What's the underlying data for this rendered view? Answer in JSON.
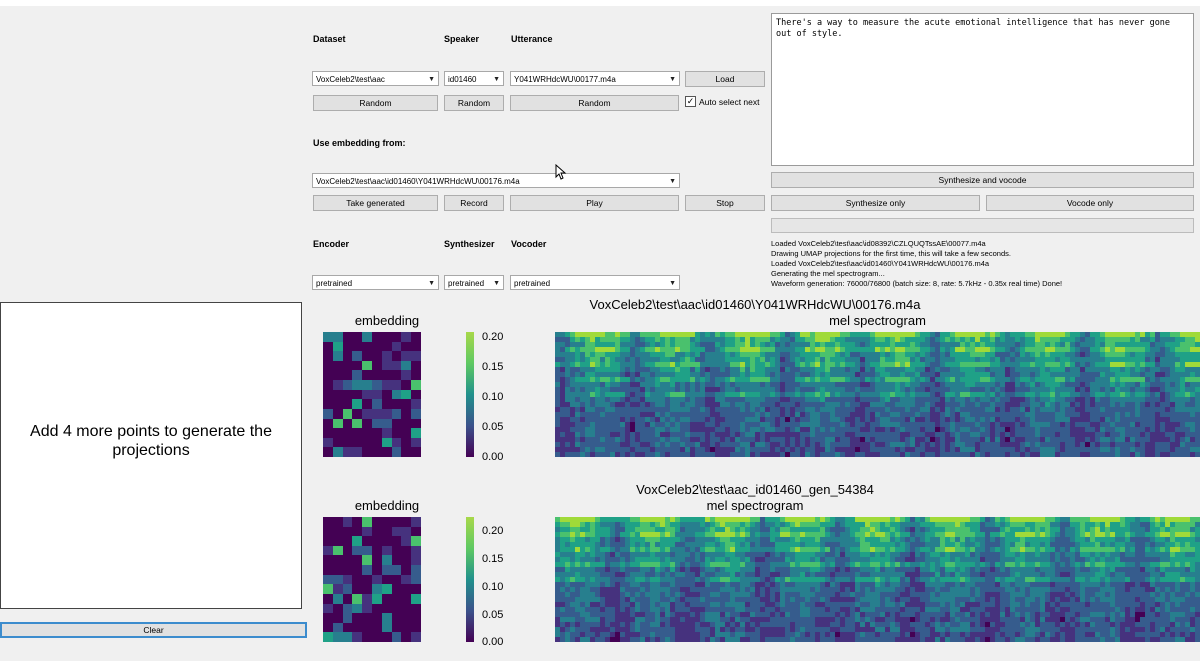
{
  "labels": {
    "dataset": "Dataset",
    "speaker": "Speaker",
    "utterance": "Utterance",
    "use_embedding": "Use embedding from:",
    "encoder": "Encoder",
    "synthesizer": "Synthesizer",
    "vocoder": "Vocoder"
  },
  "selects": {
    "dataset": "VoxCeleb2\\test\\aac",
    "speaker": "id01460",
    "utterance": "Y041WRHdcWU\\00177.m4a",
    "embedding": "VoxCeleb2\\test\\aac\\id01460\\Y041WRHdcWU\\00176.m4a",
    "encoder": "pretrained",
    "synthesizer": "pretrained",
    "vocoder": "pretrained"
  },
  "buttons": {
    "load": "Load",
    "random_dataset": "Random",
    "random_speaker": "Random",
    "random_utterance": "Random",
    "auto_select": "Auto select next",
    "take_generated": "Take generated",
    "record": "Record",
    "play": "Play",
    "stop": "Stop",
    "synthesize_vocode": "Synthesize and vocode",
    "synthesize_only": "Synthesize only",
    "vocode_only": "Vocode only",
    "clear": "Clear"
  },
  "text_input": "There's a way to measure the acute emotional intelligence that has never gone out of style.",
  "log_lines": [
    "Loaded VoxCeleb2\\test\\aac\\id08392\\CZLQUQTssAE\\00077.m4a",
    "Drawing UMAP projections for the first time, this will take a few seconds.",
    "Loaded VoxCeleb2\\test\\aac\\id01460\\Y041WRHdcWU\\00176.m4a",
    "Generating the mel spectrogram...",
    "Waveform generation: 76000/76800 (batch size: 8, rate: 5.7kHz - 0.35x real time) Done!"
  ],
  "projection_message": "Add 4 more points to generate the projections",
  "plots": {
    "top": {
      "title": "VoxCeleb2\\test\\aac\\id01460\\Y041WRHdcWU\\00176.m4a",
      "embedding_title": "embedding",
      "spectrogram_title": "mel spectrogram",
      "colorbar_ticks": [
        "0.20",
        "0.15",
        "0.10",
        "0.05",
        "0.00"
      ]
    },
    "bottom": {
      "title": "VoxCeleb2\\test\\aac_id01460_gen_54384",
      "embedding_title": "embedding",
      "spectrogram_title": "mel spectrogram",
      "colorbar_ticks": [
        "0.20",
        "0.15",
        "0.10",
        "0.05",
        "0.00"
      ]
    }
  },
  "colors": {
    "viridis_dark": "#440154",
    "viridis_mid": "#21918c",
    "viridis_bright": "#fde725",
    "accent_border": "#3c8ccd"
  }
}
